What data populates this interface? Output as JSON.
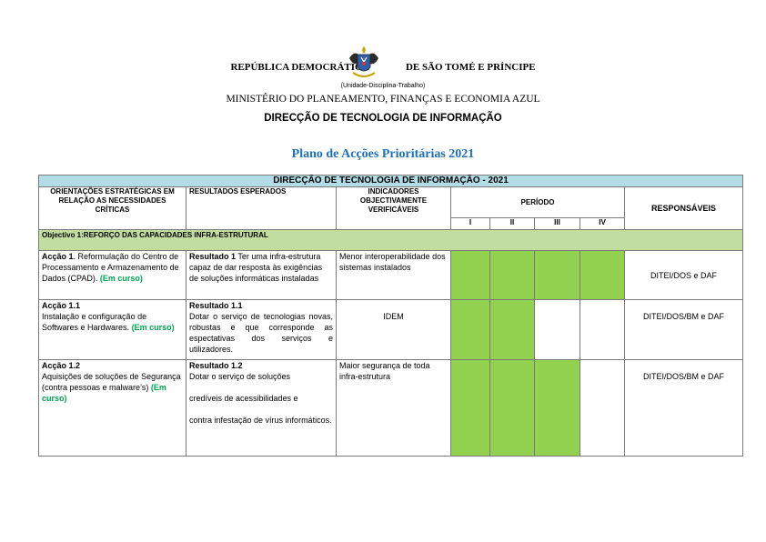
{
  "header": {
    "republic_left": "REPÚBLICA DEMOCRÁTICA",
    "republic_right": "DE SÃO TOMÉ E PRÍNCIPE",
    "motto": "(Unidade-Disciplina-Trabalho)",
    "ministry": "MINISTÉRIO DO PLANEAMENTO, FINANÇAS E ECONOMIA AZUL",
    "directorate": "DIRECÇÃO DE TECNOLOGIA DE INFORMAÇÃO",
    "plan_title": "Plano de Acções Prioritárias 2021"
  },
  "colors": {
    "green_cell": "#92d050",
    "title_row": "#b3dde6",
    "objective_row": "#c1dea0",
    "status": "#00a651",
    "plan_title": "#1f6fb5"
  },
  "table": {
    "title": "DIRECÇÃO DE TECNOLOGIA DE INFORMAÇÃO - 2021",
    "col_orientacoes": "ORIENTAÇÕES ESTRATÉGICAS EM RELAÇÃO AS NECESSIDADES CRÍTICAS",
    "col_resultados": "RESULTADOS ESPERADOS",
    "col_indicadores": "INDICADORES OBJECTIVAMENTE VERIFICÁVEIS",
    "col_periodo": "PERÍODO",
    "col_responsaveis": "RESPONSÁVEIS",
    "periods": [
      "I",
      "II",
      "III",
      "IV"
    ],
    "objective": "Objectivo 1:REFORÇO DAS CAPACIDADES INFRA-ESTRUTURAL",
    "rows": [
      {
        "action_title": "Acção 1",
        "action_text": ". Reformulação do Centro de Processamento e Armazenamento de Dados (CPAD).",
        "status": "(Em curso)",
        "result_title": "Resultado 1",
        "result_text": "Ter uma infra-estrutura capaz de dar resposta às exigências de soluções informáticas instaladas",
        "indicator": "Menor interoperabilidade dos sistemas instalados",
        "periods_active": [
          true,
          true,
          true,
          true
        ],
        "responsible": "DITEI/DOS e DAF"
      },
      {
        "action_title": "Acção 1.1",
        "action_text": "Instalação e configuração de Softwares e Hardwares.",
        "status": "(Em curso)",
        "result_title": "Resultado 1.1",
        "result_text": "Dotar o serviço de tecnologias novas, robustas e que corresponde as espectativas dos serviços e utilizadores.",
        "indicator": "IDEM",
        "periods_active": [
          true,
          true,
          false,
          false
        ],
        "responsible": "DITEI/DOS/BM e DAF"
      },
      {
        "action_title": "Acção 1.2",
        "action_text": "Aquisições de soluções de Segurança (contra pessoas e malware’s)",
        "status": "(Em curso)",
        "result_title": "Resultado 1.2",
        "result_text_1": "Dotar o serviço de soluções",
        "result_text_2": "credíveis de acessibilidades e",
        "result_text_3": "contra infestação de vírus informáticos.",
        "indicator": "Maior segurança de toda infra-estrutura",
        "periods_active": [
          true,
          true,
          true,
          false
        ],
        "responsible": "DITEI/DOS/BM e DAF"
      }
    ]
  }
}
